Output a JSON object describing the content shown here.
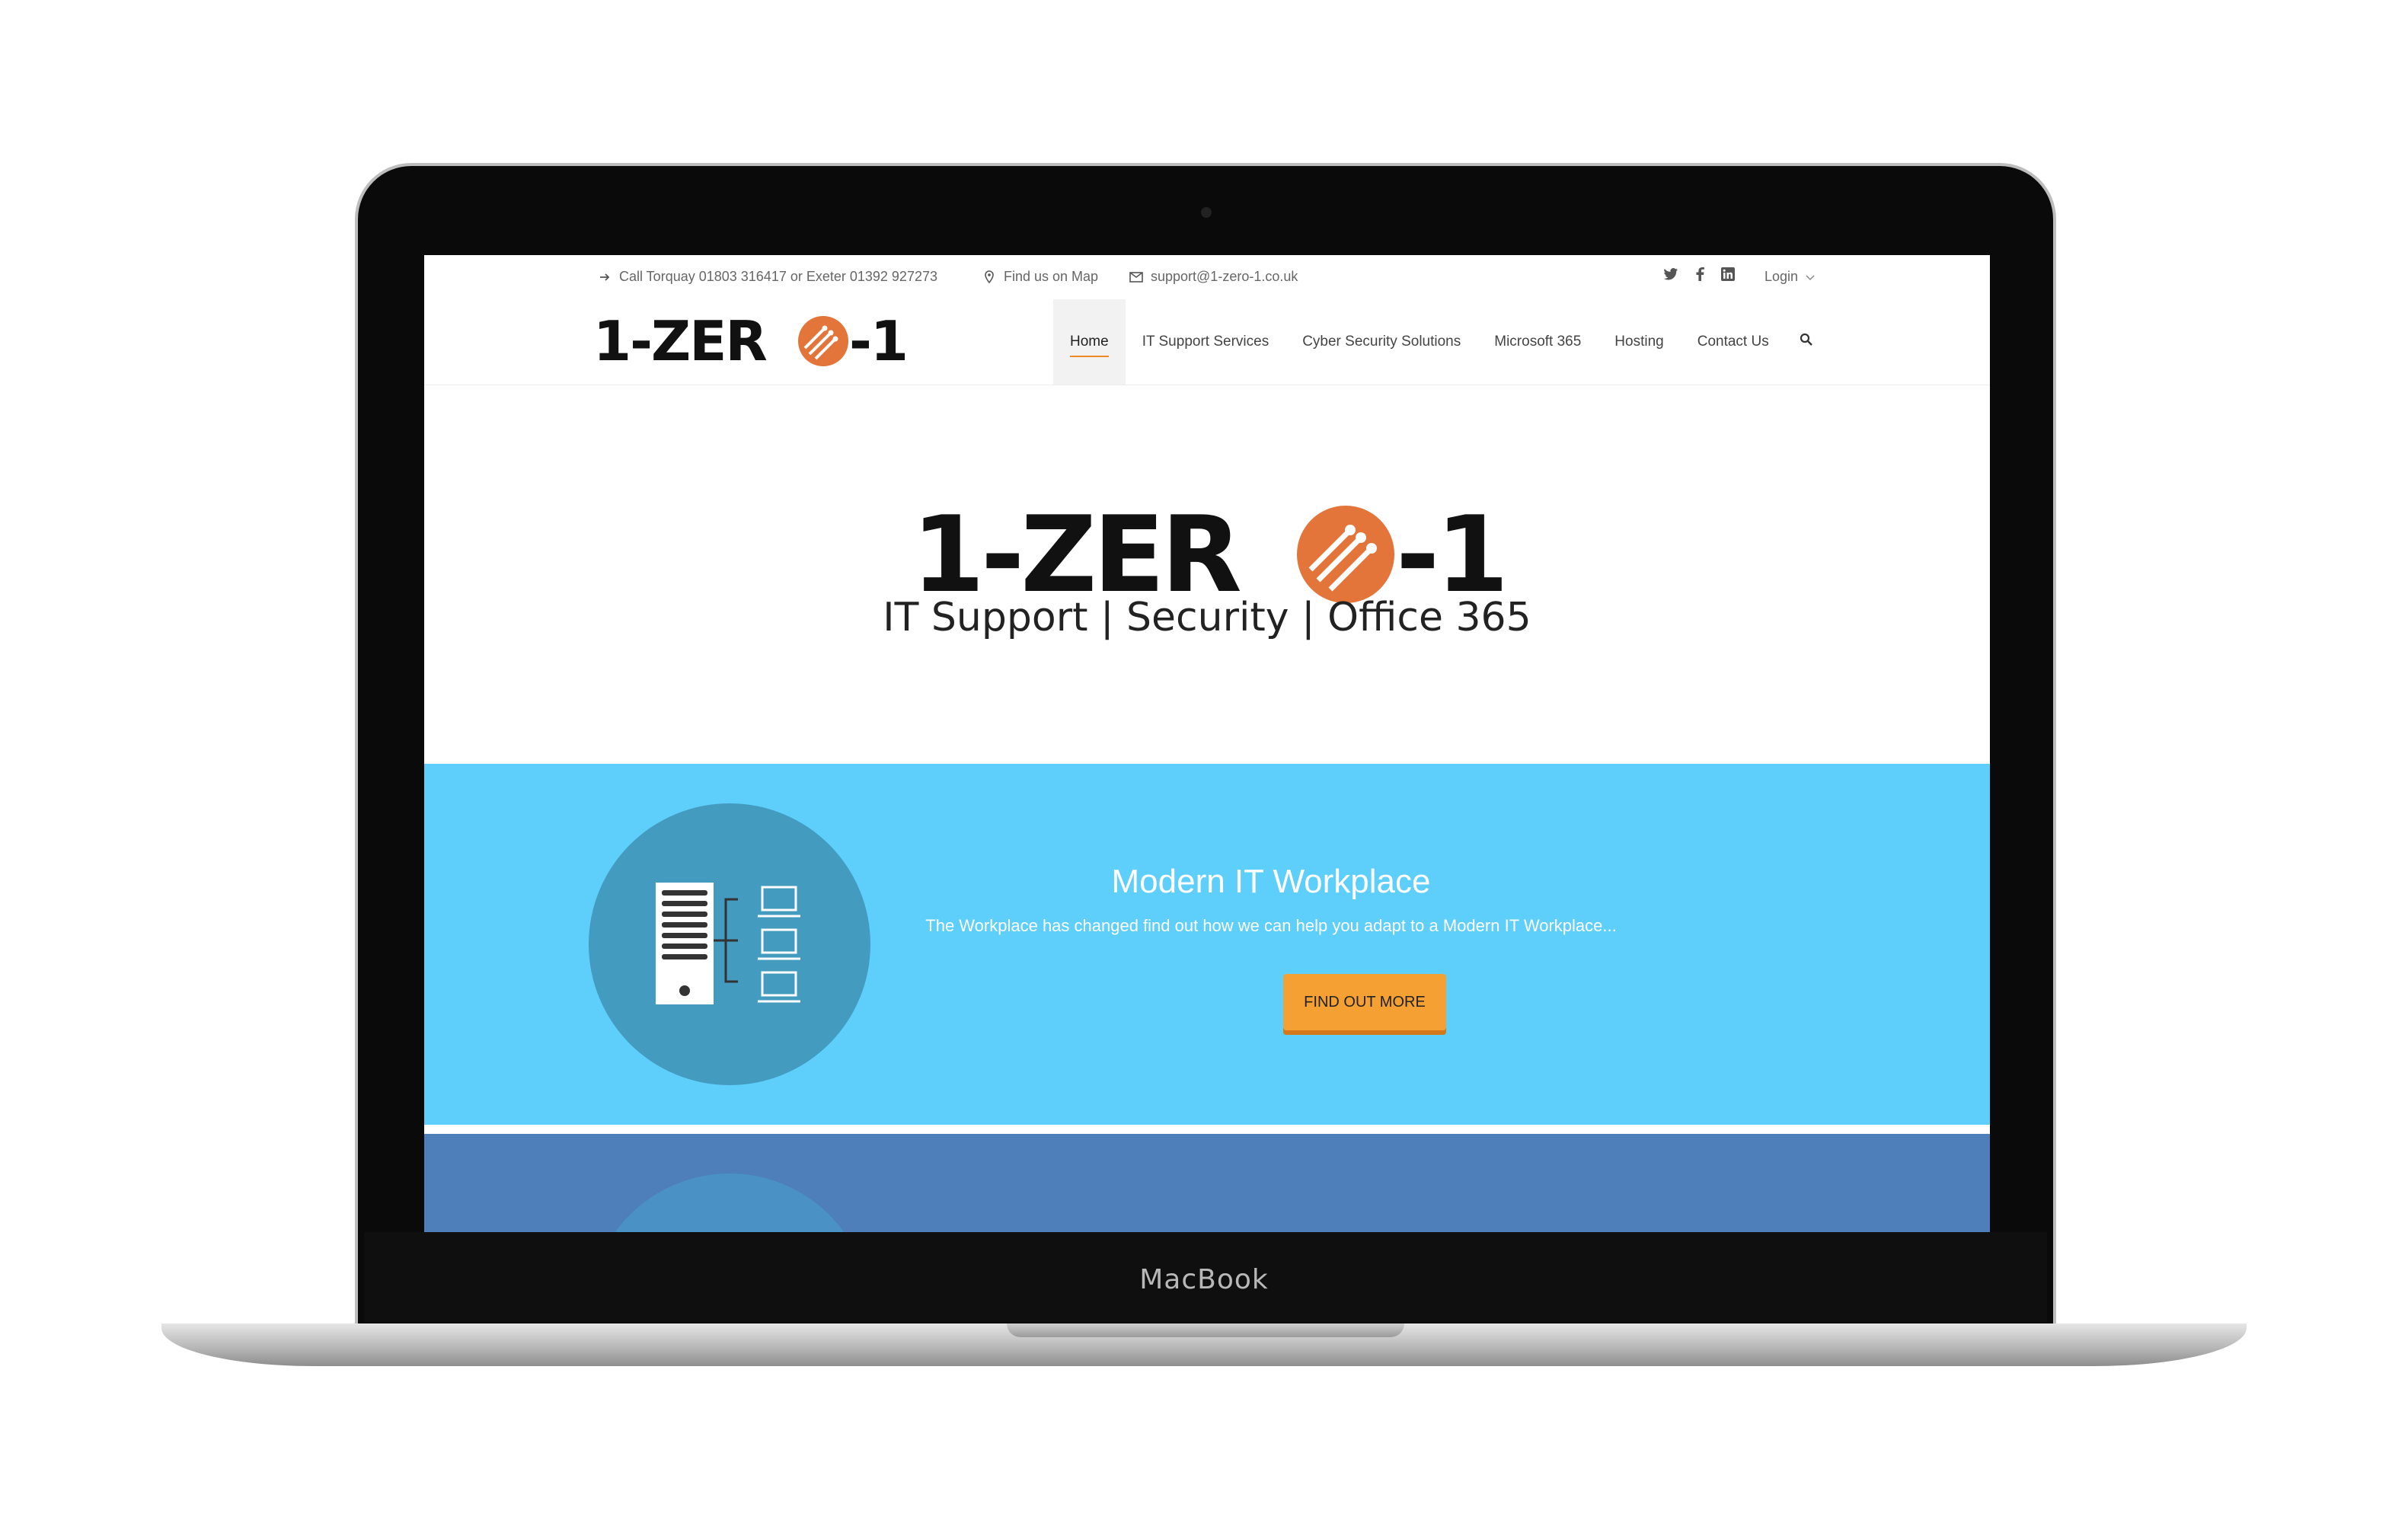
{
  "device": {
    "brand": "MacBook"
  },
  "topbar": {
    "phone": "Call Torquay 01803 316417 or Exeter 01392 927273",
    "map": "Find us on Map",
    "email": "support@1-zero-1.co.uk",
    "login": "Login",
    "social": [
      "twitter-icon",
      "facebook-icon",
      "linkedin-icon"
    ]
  },
  "logo": {
    "text": "1-ZERO-1",
    "accent": "#e3743a"
  },
  "nav": [
    {
      "label": "Home",
      "active": true
    },
    {
      "label": "IT Support Services"
    },
    {
      "label": "Cyber Security Solutions"
    },
    {
      "label": "Microsoft 365"
    },
    {
      "label": "Hosting"
    },
    {
      "label": "Contact Us"
    }
  ],
  "hero": {
    "tagline": "IT Support | Security | Office 365"
  },
  "feature": {
    "title": "Modern IT Workplace",
    "description": "The Workplace has changed find out how we can help you adapt to a Modern IT Workplace...",
    "cta": "FIND OUT MORE",
    "bg": "#5ecefb",
    "button_color": "#f5a032"
  },
  "next_section": {
    "bg": "#4e7fba"
  }
}
